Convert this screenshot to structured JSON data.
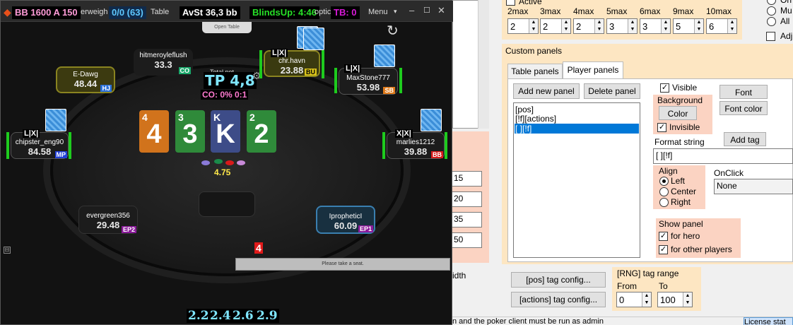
{
  "poker_window": {
    "hud_left": "BB 1600 A 150",
    "hud_stats": "0/0 (63)",
    "hud_avst": "AvSt 36,3 bb",
    "hud_blinds": "BlindsUp: 4:46",
    "hud_tb": "TB: 0",
    "hud_frag_1": "erweigh",
    "hud_frag_2": "Table",
    "hud_frag_3": "optic",
    "menu": "Menu",
    "open_table": "Open Table",
    "total_pot_label": "Total pot",
    "tp": "TP 4,8",
    "co_stat": "CO: 0% 0:1",
    "pot_amount": "4.75",
    "take_seat": "Please take a seat.",
    "red_number": "4",
    "board_cards": [
      {
        "small": "4",
        "big": "4",
        "color": "#d1731c"
      },
      {
        "small": "3",
        "big": "3",
        "color": "#2f8a3a"
      },
      {
        "small": "K",
        "big": "K",
        "color": "#3d4c88"
      },
      {
        "small": "2",
        "big": "2",
        "color": "#2f8a3a"
      }
    ],
    "bet_sizes": [
      "2.2",
      "2.4",
      "2.6",
      "2.9"
    ],
    "players": [
      {
        "name": "E-Dawg",
        "stack": "48.44",
        "pos": "HJ",
        "pos_color": "#2a6fd6"
      },
      {
        "name": "hitmeroyleflush",
        "stack": "33.3",
        "pos": "CO",
        "pos_color": "#1aa86b"
      },
      {
        "name": "chr.havn",
        "stack": "23.88",
        "pos": "BU",
        "pos_color": "#d8c21a",
        "marks": "L|X|"
      },
      {
        "name": "MaxStone777",
        "stack": "53.98",
        "pos": "SB",
        "pos_color": "#e07a1a",
        "marks": "L|X|"
      },
      {
        "name": "chipster_eng90",
        "stack": "84.58",
        "pos": "MP",
        "pos_color": "#2140d8",
        "marks": "L|X|"
      },
      {
        "name": "marlies1212",
        "stack": "39.88",
        "pos": "BB",
        "pos_color": "#d81a1a",
        "marks": "X|X|"
      },
      {
        "name": "evergreen356",
        "stack": "29.48",
        "pos": "EP2",
        "pos_color": "#8a1a9a"
      },
      {
        "name": "IprophеticI",
        "stack": "60.09",
        "pos": "EP1",
        "pos_color": "#8a1a9a"
      }
    ]
  },
  "settings": {
    "active_label": "Active",
    "max_labels": [
      "2max",
      "3max",
      "4max",
      "5max",
      "6max",
      "9max",
      "10max"
    ],
    "max_values": [
      "2",
      "2",
      "2",
      "3",
      "3",
      "5",
      "6"
    ],
    "radio_right": [
      "On",
      "Mu",
      "All"
    ],
    "adjust_label": "Adju",
    "custom_panels": "Custom panels",
    "tab_table": "Table panels",
    "tab_player": "Player panels",
    "add_panel": "Add new panel",
    "delete_panel": "Delete panel",
    "panel_list": [
      "[pos]",
      "[!f][actions]",
      "[       ][!f]"
    ],
    "visible": "Visible",
    "background": "Background",
    "color_btn": "Color",
    "invisible": "Invisible",
    "font_btn": "Font",
    "font_color_btn": "Font color",
    "add_tag": "Add tag",
    "format_string_label": "Format string",
    "format_string_value": "[       ][!f]",
    "align_label": "Align",
    "align_options": [
      "Left",
      "Center",
      "Right"
    ],
    "onclick_label": "OnClick",
    "onclick_value": "None",
    "show_panel": "Show panel",
    "for_hero": "for hero",
    "for_other": "for other players",
    "pos_tag_btn": "[pos] tag config...",
    "actions_tag_btn": "[actions] tag config...",
    "rng_label": "[RNG] tag range",
    "from_label": "From",
    "to_label": "To",
    "from_value": "0",
    "to_value": "100",
    "left_values": [
      "15",
      "20",
      "35",
      "50"
    ],
    "width_frag": "idth",
    "status_text": "n and the poker client must be run as admin",
    "license_text": "License stat"
  }
}
